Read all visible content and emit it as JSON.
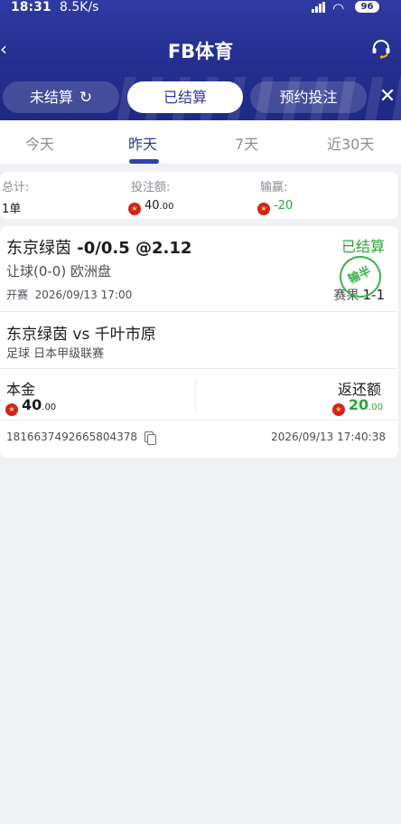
{
  "status_bar": {
    "time": "18:31",
    "speed": "8.5K/s",
    "battery": "96"
  },
  "header": {
    "back_icon": "‹",
    "title": "FB体育",
    "support_icon": "customer-service-icon"
  },
  "filter_tabs": {
    "unsettled": "未结算",
    "settled": "已结算",
    "reserved": "预约投注",
    "close": "✕"
  },
  "day_tabs": [
    "今天",
    "昨天",
    "7天",
    "近30天"
  ],
  "summary": {
    "total_label": "总计:",
    "total_value": "1单",
    "stake_label": "投注额:",
    "stake_value": "40",
    "stake_decimals": ".00",
    "winloss_label": "输赢:",
    "winloss_value": "-20"
  },
  "bet": {
    "team": "东京绿茵",
    "selection": "-0/0.5 @2.12",
    "status": "已结算",
    "market": "让球(0-0) 欧洲盘",
    "kickoff_label": "开赛",
    "kickoff_time": "2026/09/13 17:00",
    "result_stamp": "输半",
    "score_label": "赛果",
    "score": "1-1",
    "match": "东京绿茵 vs 千叶市原",
    "league": "足球  日本甲级联赛",
    "principal_label": "本金",
    "principal_int": "40",
    "principal_dec": ".00",
    "return_label": "返还额",
    "return_int": "20",
    "return_dec": ".00",
    "order_id": "1816637492665804378",
    "settle_time": "2026/09/13 17:40:38"
  },
  "colors": {
    "brand": "#2c3aa1",
    "win_green": "#2aa43b",
    "flag_red": "#d72121"
  }
}
